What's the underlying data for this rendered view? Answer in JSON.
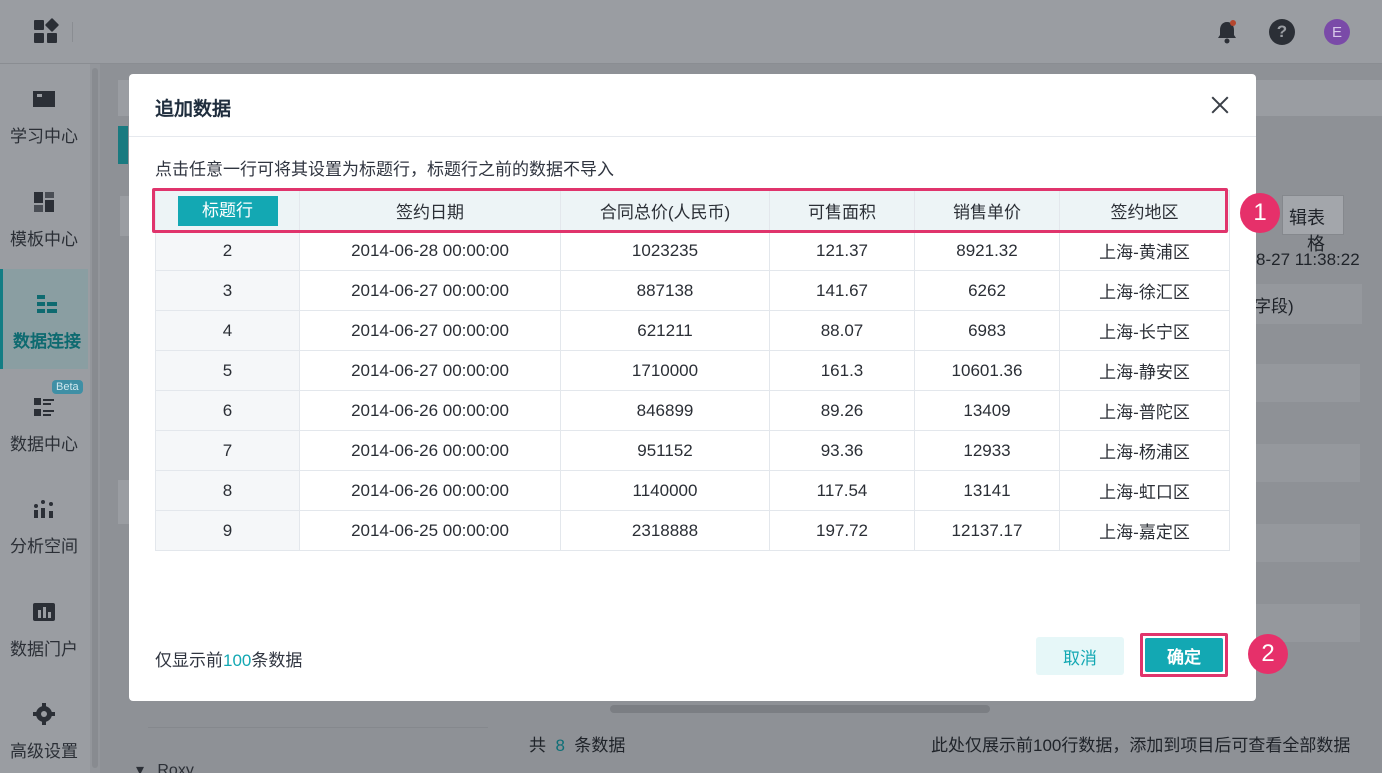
{
  "sidebar": {
    "items": [
      {
        "label": "学习中心",
        "icon": "book-icon"
      },
      {
        "label": "模板中心",
        "icon": "template-icon"
      },
      {
        "label": "数据连接",
        "icon": "data-connection-icon",
        "active": true
      },
      {
        "label": "数据中心",
        "icon": "data-center-icon",
        "badge": "Beta"
      },
      {
        "label": "分析空间",
        "icon": "analysis-icon"
      },
      {
        "label": "数据门户",
        "icon": "portal-icon"
      },
      {
        "label": "高级设置",
        "icon": "gear-icon"
      }
    ]
  },
  "background": {
    "edit_table_fragment": "辑表格",
    "timestamp_fragment": "8-27 11:38:22",
    "field_fragment": "字段)",
    "footer_total_prefix": "共",
    "footer_total_count": "8",
    "footer_total_suffix": "条数据",
    "footer_right_note": "此处仅展示前100行数据，添加到项目后可查看全部数据",
    "tree_item": "Roxy"
  },
  "modal": {
    "title": "追加数据",
    "hint": "点击任意一行可将其设置为标题行，标题行之前的数据不导入",
    "header_row_label": "标题行",
    "columns": [
      "签约日期",
      "合同总价(人民币)",
      "可售面积",
      "销售单价",
      "签约地区"
    ],
    "rows": [
      {
        "n": "2",
        "cells": [
          "2014-06-28 00:00:00",
          "1023235",
          "121.37",
          "8921.32",
          "上海-黄浦区"
        ]
      },
      {
        "n": "3",
        "cells": [
          "2014-06-27 00:00:00",
          "887138",
          "141.67",
          "6262",
          "上海-徐汇区"
        ]
      },
      {
        "n": "4",
        "cells": [
          "2014-06-27 00:00:00",
          "621211",
          "88.07",
          "6983",
          "上海-长宁区"
        ]
      },
      {
        "n": "5",
        "cells": [
          "2014-06-27 00:00:00",
          "1710000",
          "161.3",
          "10601.36",
          "上海-静安区"
        ]
      },
      {
        "n": "6",
        "cells": [
          "2014-06-26 00:00:00",
          "846899",
          "89.26",
          "13409",
          "上海-普陀区"
        ]
      },
      {
        "n": "7",
        "cells": [
          "2014-06-26 00:00:00",
          "951152",
          "93.36",
          "12933",
          "上海-杨浦区"
        ]
      },
      {
        "n": "8",
        "cells": [
          "2014-06-26 00:00:00",
          "1140000",
          "117.54",
          "13141",
          "上海-虹口区"
        ]
      },
      {
        "n": "9",
        "cells": [
          "2014-06-25 00:00:00",
          "2318888",
          "197.72",
          "12137.17",
          "上海-嘉定区"
        ]
      }
    ],
    "footer_prefix": "仅显示前",
    "footer_count": "100",
    "footer_suffix": "条数据",
    "cancel_label": "取消",
    "ok_label": "确定"
  },
  "annotations": [
    "1",
    "2"
  ],
  "colors": {
    "accent": "#13a8b3",
    "highlight": "#e0346c"
  }
}
